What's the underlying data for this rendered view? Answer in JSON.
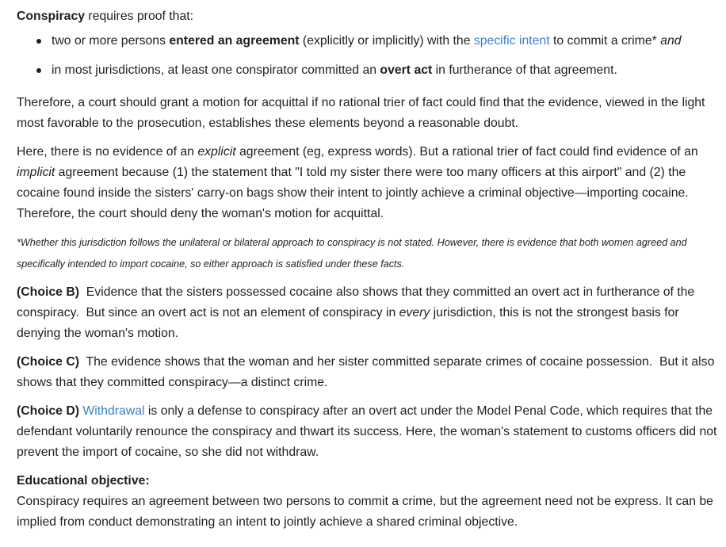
{
  "conspiracy_def": {
    "term": "Conspiracy",
    "rest": " requires proof that:"
  },
  "bullets": [
    {
      "parts": [
        {
          "text": "two or more persons ",
          "style": "normal"
        },
        {
          "text": "entered an agreement",
          "style": "bold"
        },
        {
          "text": " (explicitly or implicitly) with the ",
          "style": "normal"
        },
        {
          "text": "specific intent",
          "style": "link"
        },
        {
          "text": " to commit a crime* ",
          "style": "normal"
        },
        {
          "text": "and",
          "style": "italic"
        }
      ]
    },
    {
      "parts": [
        {
          "text": "in most jurisdictions, at least one conspirator committed an ",
          "style": "normal"
        },
        {
          "text": "overt act",
          "style": "bold"
        },
        {
          "text": " in furtherance of that agreement.",
          "style": "normal"
        }
      ]
    }
  ],
  "therefore_paragraph": "Therefore, a court should grant a motion for acquittal if no rational trier of fact could find that the evidence, viewed in the light most favorable to the prosecution, establishes these elements beyond a reasonable doubt.",
  "here_paragraph": {
    "p1": "Here, there is no evidence of an ",
    "explicit": "explicit",
    "p2": " agreement (eg, express words).  But a rational trier of fact could find evidence of an ",
    "implicit": "implicit",
    "p3": " agreement because (1) the statement that \"I told my sister there were too many officers at this airport\" and (2) the cocaine found inside the sisters' carry-on bags show their intent to jointly achieve a criminal objective—importing cocaine.  Therefore, the court should deny the woman's motion for acquittal."
  },
  "footnote": "*Whether this jurisdiction follows the unilateral or bilateral approach to conspiracy is not stated.  However, there is evidence that both women agreed and specifically intended to import cocaine, so either approach is satisfied under these facts.",
  "choice_b": {
    "label": "(Choice B)",
    "p1": "  Evidence that the sisters possessed cocaine also shows that they committed an overt act in furtherance of the conspiracy.  But since an overt act is not an element of conspiracy in ",
    "every": "every",
    "p2": " jurisdiction, this is not the strongest basis for denying the woman's motion."
  },
  "choice_c": {
    "label": "(Choice C)",
    "text": "  The evidence shows that the woman and her sister committed separate crimes of cocaine possession.  But it also shows that they committed conspiracy—a distinct crime."
  },
  "choice_d": {
    "label": "(Choice D)",
    "link": "Withdrawal",
    "text": " is only a defense to conspiracy after an overt act under the Model Penal Code, which requires that the defendant voluntarily renounce the conspiracy and thwart its success.  Here, the woman's statement to customs officers did not prevent the import of cocaine, so she did not withdraw."
  },
  "educational_objective": {
    "heading": "Educational objective:",
    "text": "Conspiracy requires an agreement between two persons to commit a crime, but the agreement need not be express.  It can be implied from conduct demonstrating an intent to jointly achieve a shared criminal objective."
  }
}
